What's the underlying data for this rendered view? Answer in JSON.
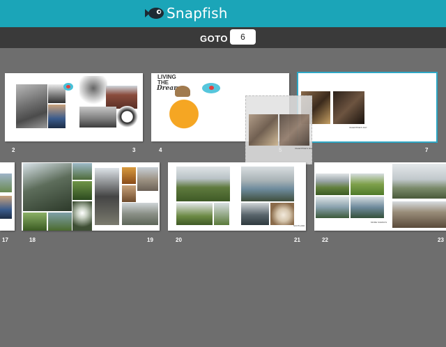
{
  "app": {
    "logo_text": "Snapfish"
  },
  "goto": {
    "label": "GOTO",
    "value": "6"
  },
  "pages": {
    "p2": "2",
    "p3": "3",
    "p4": "4",
    "p5": "5",
    "p7": "7",
    "p17": "17",
    "p18": "18",
    "p19": "19",
    "p20": "20",
    "p21": "21",
    "p22": "22",
    "p23": "23"
  },
  "texts": {
    "living": "LIVING",
    "the": "THE",
    "dream": "Dream",
    "valentine_caption_1": "VALENTINE'S DAY",
    "valentine_caption_2": "VALENTINE'S DAY",
    "scotland_caption": "SCOTLAND",
    "more_caption": "MORE SCENICS"
  },
  "colors": {
    "topbar": "#1ba5b8",
    "gotobar": "#3a3a3a",
    "canvas": "#6e6e6e",
    "selection": "#2ea7c5"
  },
  "icons": {
    "logo": "fish-icon"
  }
}
